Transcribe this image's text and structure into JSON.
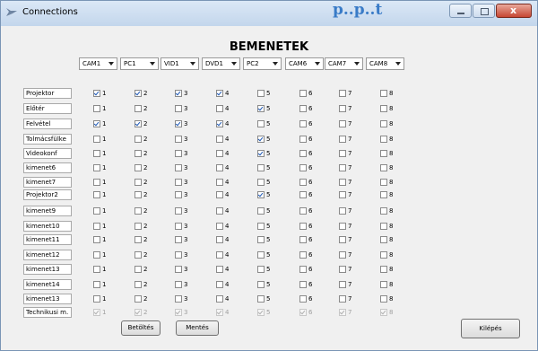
{
  "window": {
    "title": "Connections",
    "blurred_title": "p..p..t"
  },
  "heading": "BEMENETEK",
  "inputs": [
    "CAM1",
    "PC1",
    "VID1",
    "DVD1",
    "PC2",
    "CAM6",
    "CAM7",
    "CAM8"
  ],
  "numbers": [
    "1",
    "2",
    "3",
    "4",
    "5",
    "6",
    "7",
    "8"
  ],
  "rows": [
    {
      "label": "Projektor",
      "checked": [
        1,
        1,
        1,
        1,
        0,
        0,
        0,
        0
      ],
      "disabled": false
    },
    {
      "label": "Előtér",
      "checked": [
        0,
        0,
        0,
        0,
        1,
        0,
        0,
        0
      ],
      "disabled": false
    },
    {
      "label": "Felvétel",
      "checked": [
        1,
        1,
        1,
        1,
        0,
        0,
        0,
        0
      ],
      "disabled": false
    },
    {
      "label": "Tolmácsfülke",
      "checked": [
        0,
        0,
        0,
        0,
        1,
        0,
        0,
        0
      ],
      "disabled": false
    },
    {
      "label": "Videokonf",
      "checked": [
        0,
        0,
        0,
        0,
        1,
        0,
        0,
        0
      ],
      "disabled": false
    },
    {
      "label": "kimenet6",
      "checked": [
        0,
        0,
        0,
        0,
        0,
        0,
        0,
        0
      ],
      "disabled": false
    },
    {
      "label": "kimenet7",
      "checked": [
        0,
        0,
        0,
        0,
        0,
        0,
        0,
        0
      ],
      "disabled": false
    },
    {
      "label": "Projektor2",
      "checked": [
        0,
        0,
        0,
        0,
        1,
        0,
        0,
        0
      ],
      "disabled": false
    },
    {
      "label": "kimenet9",
      "checked": [
        0,
        0,
        0,
        0,
        0,
        0,
        0,
        0
      ],
      "disabled": false
    },
    {
      "label": "kimenet10",
      "checked": [
        0,
        0,
        0,
        0,
        0,
        0,
        0,
        0
      ],
      "disabled": false
    },
    {
      "label": "kimenet11",
      "checked": [
        0,
        0,
        0,
        0,
        0,
        0,
        0,
        0
      ],
      "disabled": false
    },
    {
      "label": "kimenet12",
      "checked": [
        0,
        0,
        0,
        0,
        0,
        0,
        0,
        0
      ],
      "disabled": false
    },
    {
      "label": "kimenet13",
      "checked": [
        0,
        0,
        0,
        0,
        0,
        0,
        0,
        0
      ],
      "disabled": false
    },
    {
      "label": "kimenet14",
      "checked": [
        0,
        0,
        0,
        0,
        0,
        0,
        0,
        0
      ],
      "disabled": false
    },
    {
      "label": "kimenet13",
      "checked": [
        0,
        0,
        0,
        0,
        0,
        0,
        0,
        0
      ],
      "disabled": false
    },
    {
      "label": "Technikusi m.",
      "checked": [
        1,
        1,
        1,
        1,
        1,
        1,
        1,
        1
      ],
      "disabled": true
    }
  ],
  "buttons": {
    "load": "Betöltés",
    "save": "Mentés",
    "exit": "Kilépés"
  },
  "colors": {
    "titlebar": "#c3d6ec",
    "checkmark": "#1c57b5",
    "close": "#c64632"
  }
}
